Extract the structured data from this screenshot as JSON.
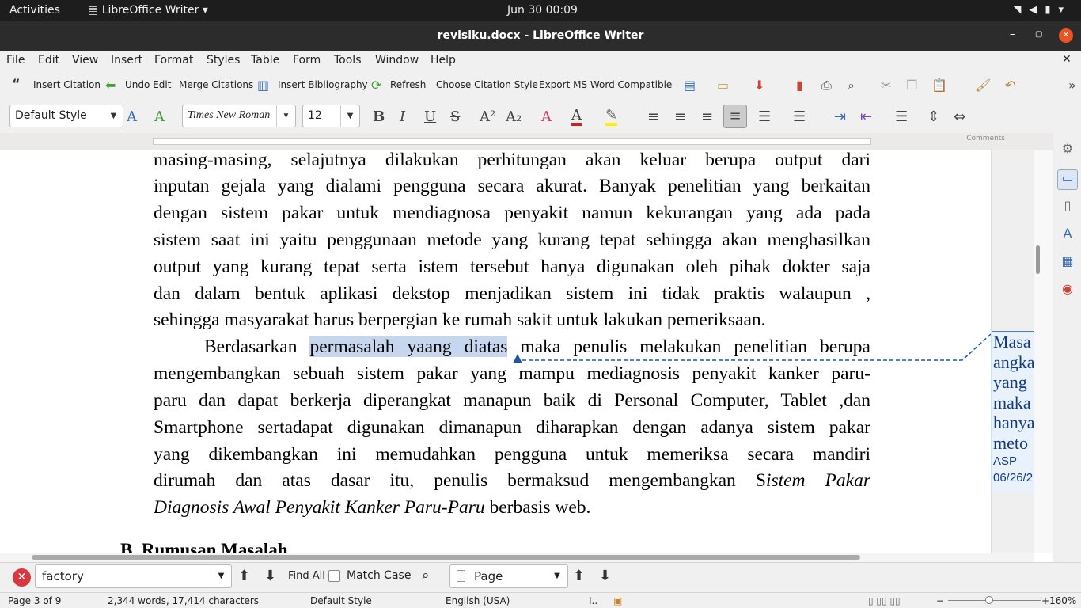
{
  "system_bar": {
    "activities": "Activities",
    "app_menu": "LibreOffice Writer",
    "clock": "Jun 30  00:09"
  },
  "window": {
    "title": "revisiku.docx - LibreOffice Writer",
    "minimize": "–",
    "maximize": "▢",
    "close": "✕"
  },
  "menu": [
    "File",
    "Edit",
    "View",
    "Insert",
    "Format",
    "Styles",
    "Table",
    "Form",
    "Tools",
    "Window",
    "Help"
  ],
  "citation_toolbar": {
    "insert_citation": "Insert Citation",
    "undo_edit": "Undo Edit",
    "merge_citations": "Merge Citations",
    "insert_bibliography": "Insert Bibliography",
    "refresh": "Refresh",
    "choose_style": "Choose Citation Style",
    "export": "Export MS Word Compatible"
  },
  "format_toolbar": {
    "paragraph_style": "Default Style",
    "font_name": "Times New Roman",
    "font_size": "12"
  },
  "ruler": {
    "comments_label": "Comments"
  },
  "document": {
    "p1": [
      "masing-masing, selajutnya dilakukan perhitungan akan keluar berupa output dari",
      "inputan gejala yang dialami pengguna secara akurat. Banyak penelitian yang berkaitan",
      "dengan sistem pakar untuk mendiagnosa penyakit namun kekurangan yang ada pada",
      "sistem saat ini yaitu penggunaan metode yang kurang tepat sehingga akan menghasilkan",
      "output yang kurang tepat serta istem tersebut hanya digunakan oleh pihak dokter saja",
      "dan dalam bentuk aplikasi dekstop menjadikan sistem ini tidak praktis walaupun ,",
      "sehingga masyarakat harus berpergian ke rumah sakit untuk lakukan pemeriksaan."
    ],
    "p2_first_pre": "Berdasarkan ",
    "p2_first_highlight": "permasalah yaang diatas",
    "p2_first_post": " maka penulis melakukan penelitian berupa",
    "p2_lines": [
      "mengembangkan sebuah sistem pakar yang mampu mediagnosis penyakit kanker paru-",
      "paru dan dapat berkerja diperangkat manapun baik di Personal Computer, Tablet ,dan",
      "Smartphone sertadapat digunakan dimanapun diharapkan dengan adanya sistem pakar",
      "yang dikembangkan ini memudahkan pengguna untuk memeriksa secara mandiri"
    ],
    "p2_line6_pre": "dirumah dan atas dasar itu, penulis bermaksud mengembangkan S",
    "p2_line6_it": "istem Pakar",
    "p2_line7_it": "Diagnosis Awal Penyakit Kanker Paru-Paru",
    "p2_line7_post": " berbasis web.",
    "heading": "B.   Rumusan Masalah"
  },
  "comment": {
    "lines": [
      "Masa",
      "angka",
      "yang",
      "maka",
      "hanya",
      "meto"
    ],
    "author": "ASP",
    "date": "06/26/2"
  },
  "find_bar": {
    "search_value": "factory",
    "find_all": "Find All",
    "match_case": "Match Case",
    "page_select": "Page"
  },
  "status_bar": {
    "page": "Page 3 of 9",
    "words": "2,344 words, 17,414 characters",
    "style": "Default Style",
    "language": "English (USA)",
    "zoom": "160%"
  }
}
